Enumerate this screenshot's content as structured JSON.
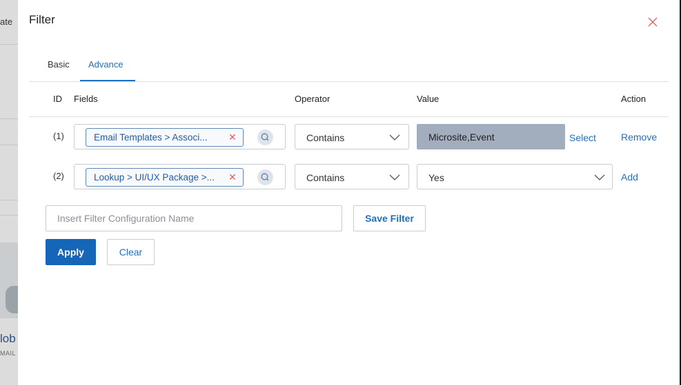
{
  "background": {
    "top_text": "ate",
    "bold_text": "lob",
    "small_text": "MAIL"
  },
  "modal": {
    "title": "Filter"
  },
  "tabs": [
    {
      "label": "Basic",
      "active": false
    },
    {
      "label": "Advance",
      "active": true
    }
  ],
  "table": {
    "headers": {
      "id": "ID",
      "fields": "Fields",
      "operator": "Operator",
      "value": "Value",
      "action": "Action"
    },
    "rows": [
      {
        "id": "(1)",
        "field": "Email Templates > Associ...",
        "operator": "Contains",
        "value": "Microsite,Event",
        "select_link": "Select",
        "action": "Remove"
      },
      {
        "id": "(2)",
        "field": "Lookup > UI/UX Package >...",
        "operator": "Contains",
        "value": "Yes",
        "action": "Add"
      }
    ]
  },
  "config": {
    "placeholder": "Insert Filter Configuration Name",
    "save_label": "Save Filter",
    "apply_label": "Apply",
    "clear_label": "Clear"
  },
  "colors": {
    "accent": "#1f6fc0",
    "primary_button": "#1565b9",
    "value_filled_bg": "#a2adbd",
    "close_icon": "#e06060"
  }
}
